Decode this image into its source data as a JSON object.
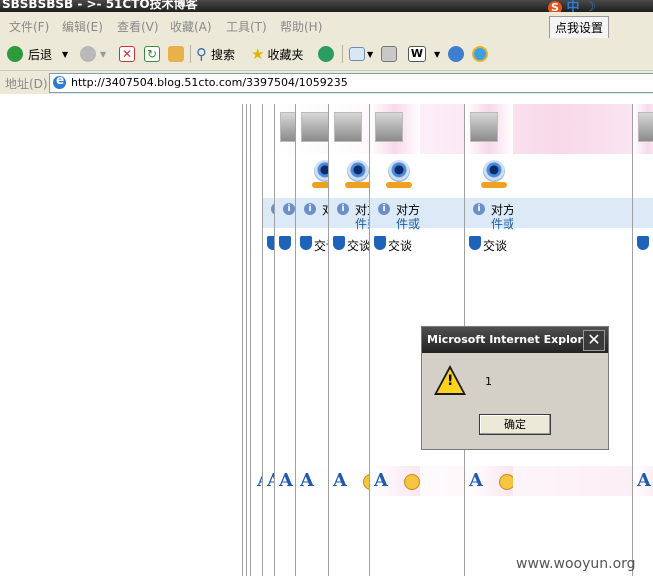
{
  "window": {
    "title": "SBSBSBSB - >- 51CTO技术博客",
    "ime_label": "中",
    "ime_tooltip": "点我设置"
  },
  "menubar": {
    "items": [
      "文件(F)",
      "编辑(E)",
      "查看(V)",
      "收藏(A)",
      "工具(T)",
      "帮助(H)"
    ]
  },
  "toolbar": {
    "back_label": "后退",
    "search_label": "搜索",
    "favorites_label": "收藏夹"
  },
  "address": {
    "label": "地址(D)",
    "url": "http://3407504.blog.51cto.com/3397504/1059235"
  },
  "page_layers": {
    "row1_text": "对方",
    "row2_text": "件或",
    "row3_text": "交谈",
    "font_glyph": "A",
    "count_shown": 10
  },
  "dialog": {
    "title": "Microsoft Internet Explorer",
    "close_glyph": "✕",
    "message": "1",
    "ok_label": "确定"
  },
  "watermark": "www.wooyun.org",
  "colors": {
    "titlebar": "#2a2a2a",
    "chrome": "#ece9d8",
    "link_blue": "#1b5fa8",
    "pink_header": "#f8d8ea"
  }
}
